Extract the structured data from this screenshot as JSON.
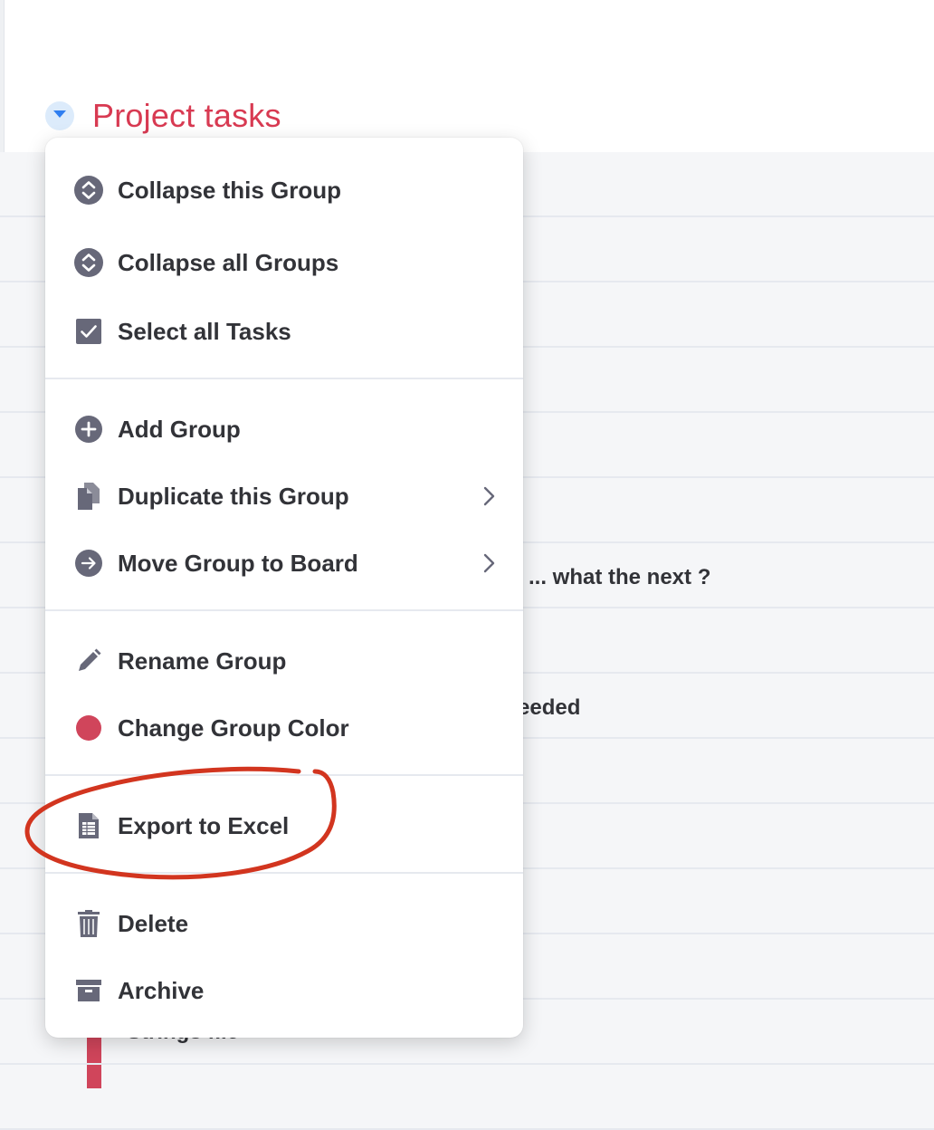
{
  "group": {
    "title": "Project tasks",
    "color": "#d83a52"
  },
  "rows": [
    {
      "text": ""
    },
    {
      "text": ""
    },
    {
      "text": ""
    },
    {
      "text": ""
    },
    {
      "text": ""
    },
    {
      "text": "... what the next ?"
    },
    {
      "text": ""
    },
    {
      "text": "eeded"
    },
    {
      "text": ""
    },
    {
      "text": ""
    },
    {
      "text": ""
    },
    {
      "text": ""
    },
    {
      "text": "Strings file"
    }
  ],
  "menu": {
    "items": [
      {
        "label": "Collapse this Group",
        "icon": "collapse-icon"
      },
      {
        "label": "Collapse all Groups",
        "icon": "collapse-icon"
      },
      {
        "label": "Select all Tasks",
        "icon": "checkbox-icon"
      },
      {
        "label": "Add Group",
        "icon": "add-circle-icon"
      },
      {
        "label": "Duplicate this Group",
        "icon": "duplicate-icon",
        "submenu": true
      },
      {
        "label": "Move Group to Board",
        "icon": "arrow-circle-icon",
        "submenu": true
      },
      {
        "label": "Rename Group",
        "icon": "pencil-icon"
      },
      {
        "label": "Change Group Color",
        "icon": "color-dot-icon",
        "color": "#d0455b"
      },
      {
        "label": "Export to Excel",
        "icon": "spreadsheet-icon"
      },
      {
        "label": "Delete",
        "icon": "trash-icon"
      },
      {
        "label": "Archive",
        "icon": "archive-icon"
      }
    ]
  },
  "annotation_color": "#d2351f"
}
